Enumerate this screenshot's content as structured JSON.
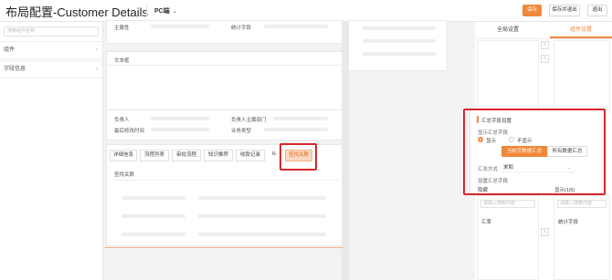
{
  "header": {
    "title": "布局配置-Customer Details",
    "device": "PC端",
    "buttons": {
      "save": "保存",
      "save_exit": "保存并退出",
      "exit": "退出"
    },
    "accent": "#f0883a"
  },
  "left": {
    "search_placeholder": "搜索组件名称",
    "items": [
      "组件",
      "字段信息"
    ]
  },
  "canvas": {
    "top_labels": {
      "owner_attr": "主属性",
      "stat_field": "统计字段"
    },
    "textbox_label": "文本框",
    "info_labels": {
      "owner": "负责人",
      "owner_dept": "负责人主属部门",
      "last_modified": "最后修改时间",
      "biz_type": "业务类型"
    },
    "tabs": [
      "详细信息",
      "流程列表",
      "审批流程",
      "知识推荐",
      "收款记录",
      "从",
      "查找关联"
    ],
    "lookup_title": "查找关联"
  },
  "right": {
    "tabs": {
      "global": "全局设置",
      "component": "组件设置"
    },
    "summary": {
      "title": "汇总字段设置",
      "show_label": "显示汇总字段",
      "show": "显示",
      "hide": "不显示",
      "scope_current": "当前页数据汇总",
      "scope_all": "所有数据汇总",
      "method_label": "汇总方式",
      "method_value": "求和",
      "fields_label": "设置汇总字段",
      "hidden": "隐藏",
      "shown": "显示(1/5)"
    },
    "search_placeholder": "请输入搜索内容",
    "left_item": "汇率",
    "right_item": "统计字段"
  }
}
